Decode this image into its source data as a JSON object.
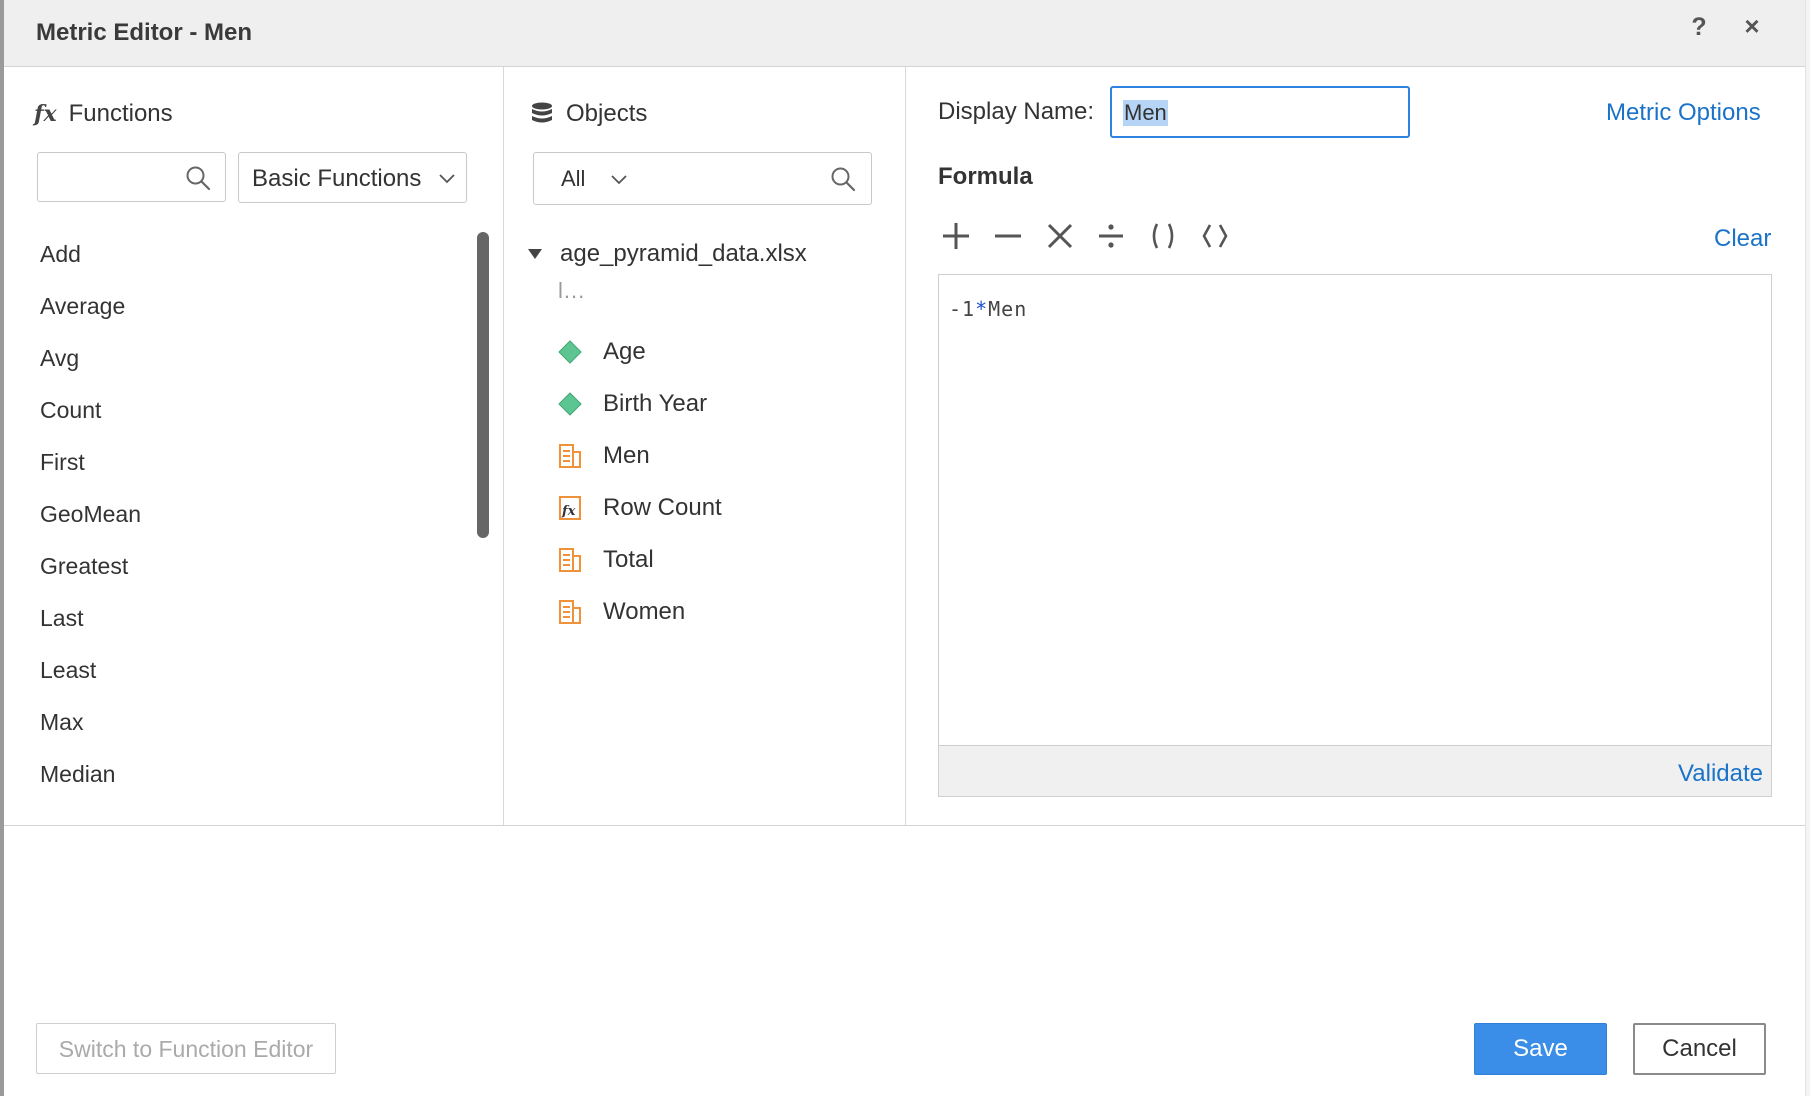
{
  "dialog": {
    "title": "Metric Editor - Men",
    "help_label": "?",
    "close_label": "×"
  },
  "functions": {
    "heading": "Functions",
    "heading_icon": "fx",
    "search_value": "",
    "search_placeholder": "",
    "category": "Basic Functions",
    "items": [
      "Add",
      "Average",
      "Avg",
      "Count",
      "First",
      "GeoMean",
      "Greatest",
      "Last",
      "Least",
      "Max",
      "Median"
    ]
  },
  "objects": {
    "heading": "Objects",
    "filter": "All",
    "root": "age_pyramid_data.xlsx",
    "ellipsis": "l...",
    "items": [
      {
        "label": "Age",
        "icon": "attribute-icon"
      },
      {
        "label": "Birth Year",
        "icon": "attribute-icon"
      },
      {
        "label": "Men",
        "icon": "metric-icon"
      },
      {
        "label": "Row Count",
        "icon": "formula-metric-icon"
      },
      {
        "label": "Total",
        "icon": "metric-icon"
      },
      {
        "label": "Women",
        "icon": "metric-icon"
      }
    ]
  },
  "editor": {
    "display_name_label": "Display Name:",
    "display_name_value": "Men",
    "metric_options": "Metric Options",
    "formula_label": "Formula",
    "clear": "Clear",
    "formula": {
      "left": "-1",
      "operator": "*",
      "right": "Men"
    },
    "validate": "Validate"
  },
  "footer": {
    "switch_label": "Switch to Function Editor",
    "save_label": "Save",
    "cancel_label": "Cancel"
  },
  "colors": {
    "accent": "#3b8ee8",
    "link": "#1a73c8",
    "attribute": "#5cc592",
    "metric": "#f0923a"
  }
}
